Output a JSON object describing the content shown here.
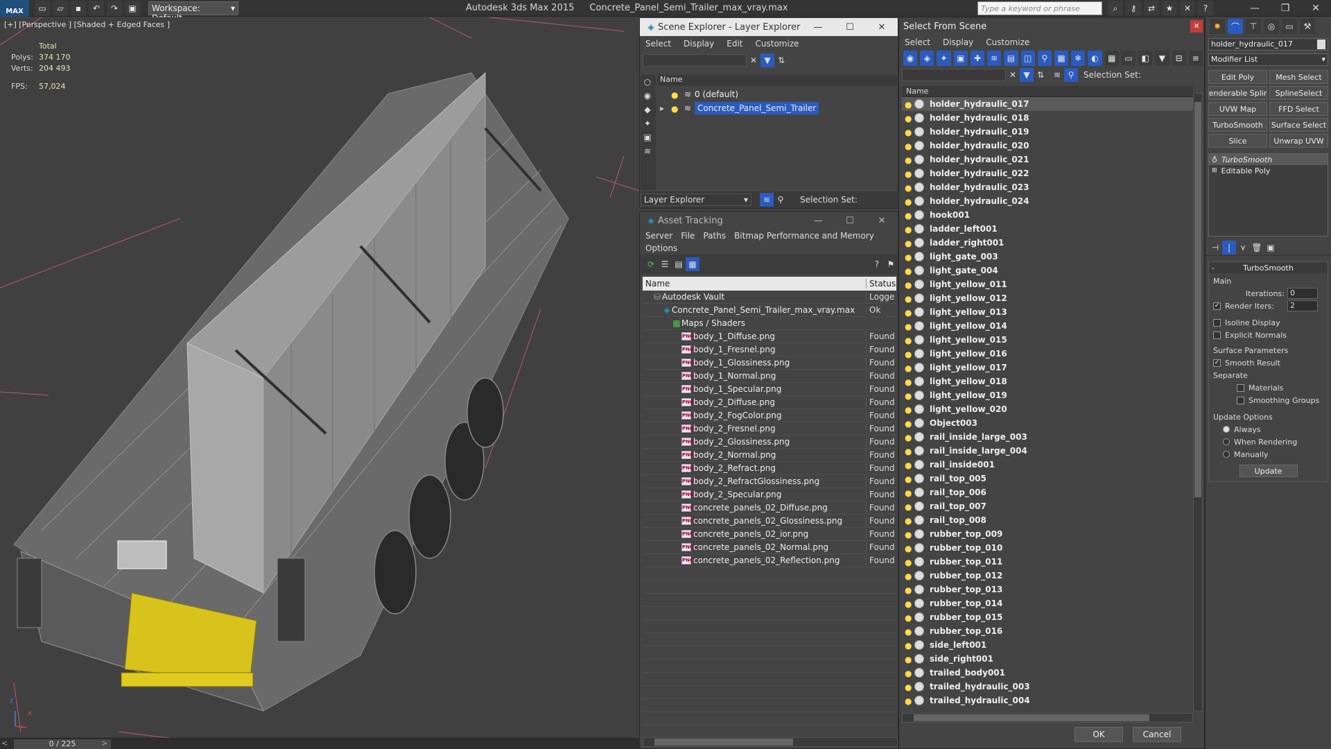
{
  "app": {
    "logo_text": "MAX",
    "title": "Autodesk 3ds Max  2015",
    "file": "Concrete_Panel_Semi_Trailer_max_vray.max",
    "workspace": "Workspace: Default",
    "search_placeholder": "Type a keyword or phrase"
  },
  "viewport": {
    "label": "[+] [Perspective ] [Shaded + Edged Faces ]",
    "stats": {
      "total_label": "Total",
      "polys_label": "Polys:",
      "polys": "374 170",
      "verts_label": "Verts:",
      "verts": "204 493",
      "fps_label": "FPS:",
      "fps": "57,024"
    },
    "frame": "0 / 225",
    "axis_z": "z",
    "axis_x": "x"
  },
  "scene_explorer": {
    "title": "Scene Explorer - Layer Explorer",
    "menu": [
      "Select",
      "Display",
      "Edit",
      "Customize"
    ],
    "col_name": "Name",
    "layers": [
      {
        "name": "0 (default)",
        "selected": false
      },
      {
        "name": "Concrete_Panel_Semi_Trailer",
        "selected": true
      }
    ],
    "bottom_label": "Layer Explorer",
    "selection_set": "Selection Set:"
  },
  "asset_tracking": {
    "title": "Asset Tracking",
    "menu": [
      "Server",
      "File",
      "Paths",
      "Bitmap Performance and Memory"
    ],
    "menu2": [
      "Options"
    ],
    "col_name": "Name",
    "col_status": "Status",
    "rows": [
      {
        "name": "Autodesk Vault",
        "status": "Logge",
        "indent": 1,
        "icon": "vault-icon"
      },
      {
        "name": "Concrete_Panel_Semi_Trailer_max_vray.max",
        "status": "Ok",
        "indent": 2,
        "icon": "max-file-icon"
      },
      {
        "name": "Maps / Shaders",
        "status": "",
        "indent": 3,
        "icon": "maps-icon"
      },
      {
        "name": "body_1_Diffuse.png",
        "status": "Found",
        "indent": 4,
        "icon": "png-icon"
      },
      {
        "name": "body_1_Fresnel.png",
        "status": "Found",
        "indent": 4,
        "icon": "png-icon"
      },
      {
        "name": "body_1_Glossiness.png",
        "status": "Found",
        "indent": 4,
        "icon": "png-icon"
      },
      {
        "name": "body_1_Normal.png",
        "status": "Found",
        "indent": 4,
        "icon": "png-icon"
      },
      {
        "name": "body_1_Specular.png",
        "status": "Found",
        "indent": 4,
        "icon": "png-icon"
      },
      {
        "name": "body_2_Diffuse.png",
        "status": "Found",
        "indent": 4,
        "icon": "png-icon"
      },
      {
        "name": "body_2_FogColor.png",
        "status": "Found",
        "indent": 4,
        "icon": "png-icon"
      },
      {
        "name": "body_2_Fresnel.png",
        "status": "Found",
        "indent": 4,
        "icon": "png-icon"
      },
      {
        "name": "body_2_Glossiness.png",
        "status": "Found",
        "indent": 4,
        "icon": "png-icon"
      },
      {
        "name": "body_2_Normal.png",
        "status": "Found",
        "indent": 4,
        "icon": "png-icon"
      },
      {
        "name": "body_2_Refract.png",
        "status": "Found",
        "indent": 4,
        "icon": "png-icon"
      },
      {
        "name": "body_2_RefractGlossiness.png",
        "status": "Found",
        "indent": 4,
        "icon": "png-icon"
      },
      {
        "name": "body_2_Specular.png",
        "status": "Found",
        "indent": 4,
        "icon": "png-icon"
      },
      {
        "name": "concrete_panels_02_Diffuse.png",
        "status": "Found",
        "indent": 4,
        "icon": "png-icon"
      },
      {
        "name": "concrete_panels_02_Glossiness.png",
        "status": "Found",
        "indent": 4,
        "icon": "png-icon"
      },
      {
        "name": "concrete_panels_02_ior.png",
        "status": "Found",
        "indent": 4,
        "icon": "png-icon"
      },
      {
        "name": "concrete_panels_02_Normal.png",
        "status": "Found",
        "indent": 4,
        "icon": "png-icon"
      },
      {
        "name": "concrete_panels_02_Reflection.png",
        "status": "Found",
        "indent": 4,
        "icon": "png-icon"
      }
    ],
    "png_badge": "PNG"
  },
  "select_from_scene": {
    "title": "Select From Scene",
    "menu": [
      "Select",
      "Display",
      "Customize"
    ],
    "selection_set": "Selection Set:",
    "col_name": "Name",
    "items": [
      "holder_hydraulic_017",
      "holder_hydraulic_018",
      "holder_hydraulic_019",
      "holder_hydraulic_020",
      "holder_hydraulic_021",
      "holder_hydraulic_022",
      "holder_hydraulic_023",
      "holder_hydraulic_024",
      "hook001",
      "ladder_left001",
      "ladder_right001",
      "light_gate_003",
      "light_gate_004",
      "light_yellow_011",
      "light_yellow_012",
      "light_yellow_013",
      "light_yellow_014",
      "light_yellow_015",
      "light_yellow_016",
      "light_yellow_017",
      "light_yellow_018",
      "light_yellow_019",
      "light_yellow_020",
      "Object003",
      "rail_inside_large_003",
      "rail_inside_large_004",
      "rail_inside001",
      "rail_top_005",
      "rail_top_006",
      "rail_top_007",
      "rail_top_008",
      "rubber_top_009",
      "rubber_top_010",
      "rubber_top_011",
      "rubber_top_012",
      "rubber_top_013",
      "rubber_top_014",
      "rubber_top_015",
      "rubber_top_016",
      "side_left001",
      "side_right001",
      "trailed_body001",
      "trailed_hydraulic_003",
      "trailed_hydraulic_004"
    ],
    "selected_index": 0,
    "ok": "OK",
    "cancel": "Cancel"
  },
  "command_panel": {
    "object_name": "holder_hydraulic_017",
    "modifier_list": "Modifier List",
    "buttons": [
      "Edit Poly",
      "Mesh Select",
      "enderable Splir",
      "SplineSelect",
      "UVW Map",
      "FFD Select",
      "TurboSmooth",
      "Surface Select",
      "Slice",
      "Unwrap UVW"
    ],
    "stack": [
      "TurboSmooth",
      "Editable Poly"
    ],
    "rollout_title": "TurboSmooth",
    "main_label": "Main",
    "iterations_label": "Iterations:",
    "iterations": "0",
    "render_iters_label": "Render Iters:",
    "render_iters": "2",
    "isoline": "Isoline Display",
    "explicit_normals": "Explicit Normals",
    "surface_params": "Surface Parameters",
    "smooth_result": "Smooth Result",
    "separate": "Separate",
    "materials": "Materials",
    "smoothing_groups": "Smoothing Groups",
    "update_options": "Update Options",
    "always": "Always",
    "when_rendering": "When Rendering",
    "manually": "Manually",
    "update": "Update"
  },
  "colors": {
    "selection_blue": "#2a5bbf",
    "bulb_yellow": "#ffd94a",
    "panel_bg": "#444444",
    "trailer_yellow": "#d8c21c"
  }
}
